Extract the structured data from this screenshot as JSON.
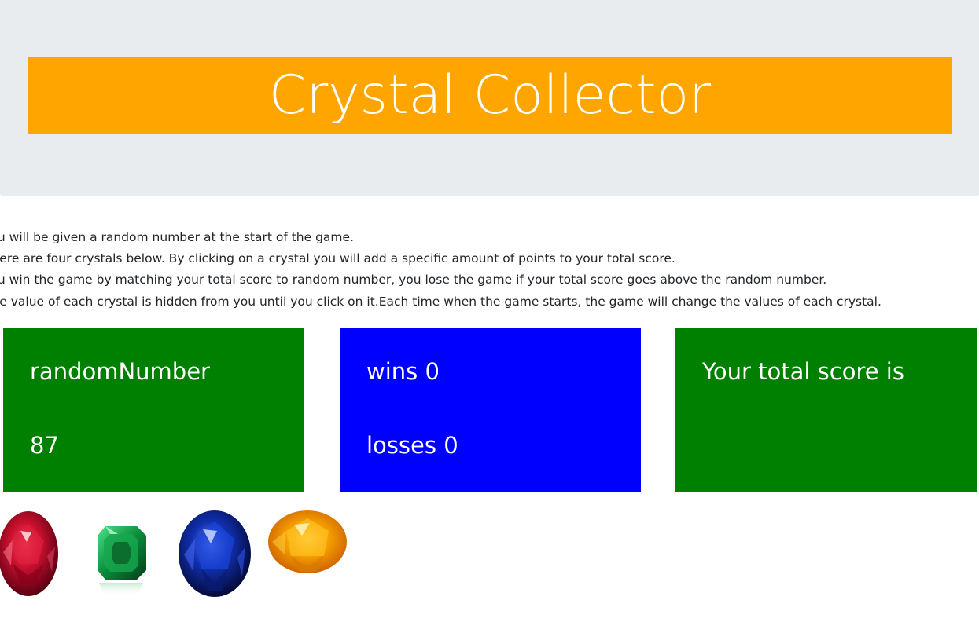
{
  "header": {
    "title": "Crystal Collector"
  },
  "instructions": [
    "You will be given a random number at the start of the game.",
    "There are four crystals below. By clicking on a crystal you will add a specific amount of points to your total score.",
    "You win the game by matching your total score to random number, you lose the game if your total score goes above the random number.",
    "The value of each crystal is hidden from you until you click on it.Each time when the game starts, the game will change the values of each crystal."
  ],
  "random_box": {
    "label": "randomNumber",
    "value": "87"
  },
  "stats_box": {
    "wins_label": "wins",
    "wins": "0",
    "losses_label": "losses",
    "losses": "0"
  },
  "score_box": {
    "label": "Your total score is",
    "value": ""
  },
  "crystals": [
    {
      "name": "ruby",
      "color": "#c0102a"
    },
    {
      "name": "emerald",
      "color": "#0a8a3a"
    },
    {
      "name": "sapphire",
      "color": "#1030b0"
    },
    {
      "name": "citrine",
      "color": "#f5a000"
    }
  ],
  "colors": {
    "jumbotron_bg": "#e9ecef",
    "title_bg": "#ffa500",
    "green_box": "#008000",
    "blue_box": "#0000ff"
  }
}
